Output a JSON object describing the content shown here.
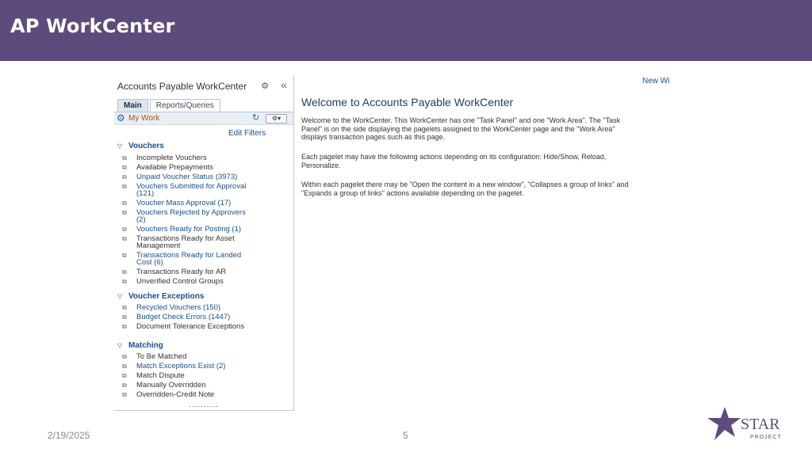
{
  "slide": {
    "title": "AP WorkCenter",
    "date": "2/19/2025",
    "page_number": "5",
    "colors": {
      "header_bg": "#5e4b7e",
      "link": "#1a4f8c"
    }
  },
  "logo": {
    "text": "STAR",
    "subtext": "PROJECT"
  },
  "task_panel": {
    "title": "Accounts Payable WorkCenter",
    "tabs": [
      {
        "label": "Main",
        "active": true
      },
      {
        "label": "Reports/Queries",
        "active": false
      }
    ],
    "my_work_label": "My Work",
    "edit_filters_label": "Edit Filters",
    "sections": [
      {
        "title": "Vouchers",
        "items": [
          {
            "label": "Incomplete Vouchers",
            "link": false
          },
          {
            "label": "Available Prepayments",
            "link": false
          },
          {
            "label": "Unpaid Voucher Status (3973)",
            "link": true
          },
          {
            "label": "Vouchers Submitted for Approval (121)",
            "link": true
          },
          {
            "label": "Voucher Mass Approval (17)",
            "link": true
          },
          {
            "label": "Vouchers Rejected by Approvers (2)",
            "link": true
          },
          {
            "label": "Vouchers Ready for Posting (1)",
            "link": true
          },
          {
            "label": "Transactions Ready for Asset Management",
            "link": false
          },
          {
            "label": "Transactions Ready for Landed Cost (6)",
            "link": true
          },
          {
            "label": "Transactions Ready for AR",
            "link": false
          },
          {
            "label": "Unverified Control Groups",
            "link": false
          }
        ]
      },
      {
        "title": "Voucher Exceptions",
        "items": [
          {
            "label": "Recycled Vouchers (150)",
            "link": true
          },
          {
            "label": "Budget Check Errors (1447)",
            "link": true
          },
          {
            "label": "Document Tolerance Exceptions",
            "link": false
          }
        ]
      },
      {
        "title": "Matching",
        "items": [
          {
            "label": "To Be Matched",
            "link": false
          },
          {
            "label": "Match Exceptions Exist (2)",
            "link": true
          },
          {
            "label": "Match Dispute",
            "link": false
          },
          {
            "label": "Manually Overridden",
            "link": false
          },
          {
            "label": "Overridden-Credit Note",
            "link": false
          }
        ]
      }
    ],
    "more_indicator": ".........."
  },
  "work_area": {
    "new_window_label": "New Wi",
    "welcome_title": "Welcome to Accounts Payable WorkCenter",
    "paragraphs": [
      "Welcome to the WorkCenter. This WorkCenter has one \"Task Panel\" and one \"Work Area\". The \"Task Panel\" is on the side displaying the pagelets assigned to the WorkCenter page and the \"Work Area\" displays transaction pages such as this page.",
      "Each pagelet may have the following actions depending on its configuration: Hide/Show, Reload, Personalize.",
      "Within each pagelet there may be \"Open the content in a new window\", \"Collapses a group of links\" and \"Expands a group of links\" actions available depending on the pagelet."
    ]
  }
}
